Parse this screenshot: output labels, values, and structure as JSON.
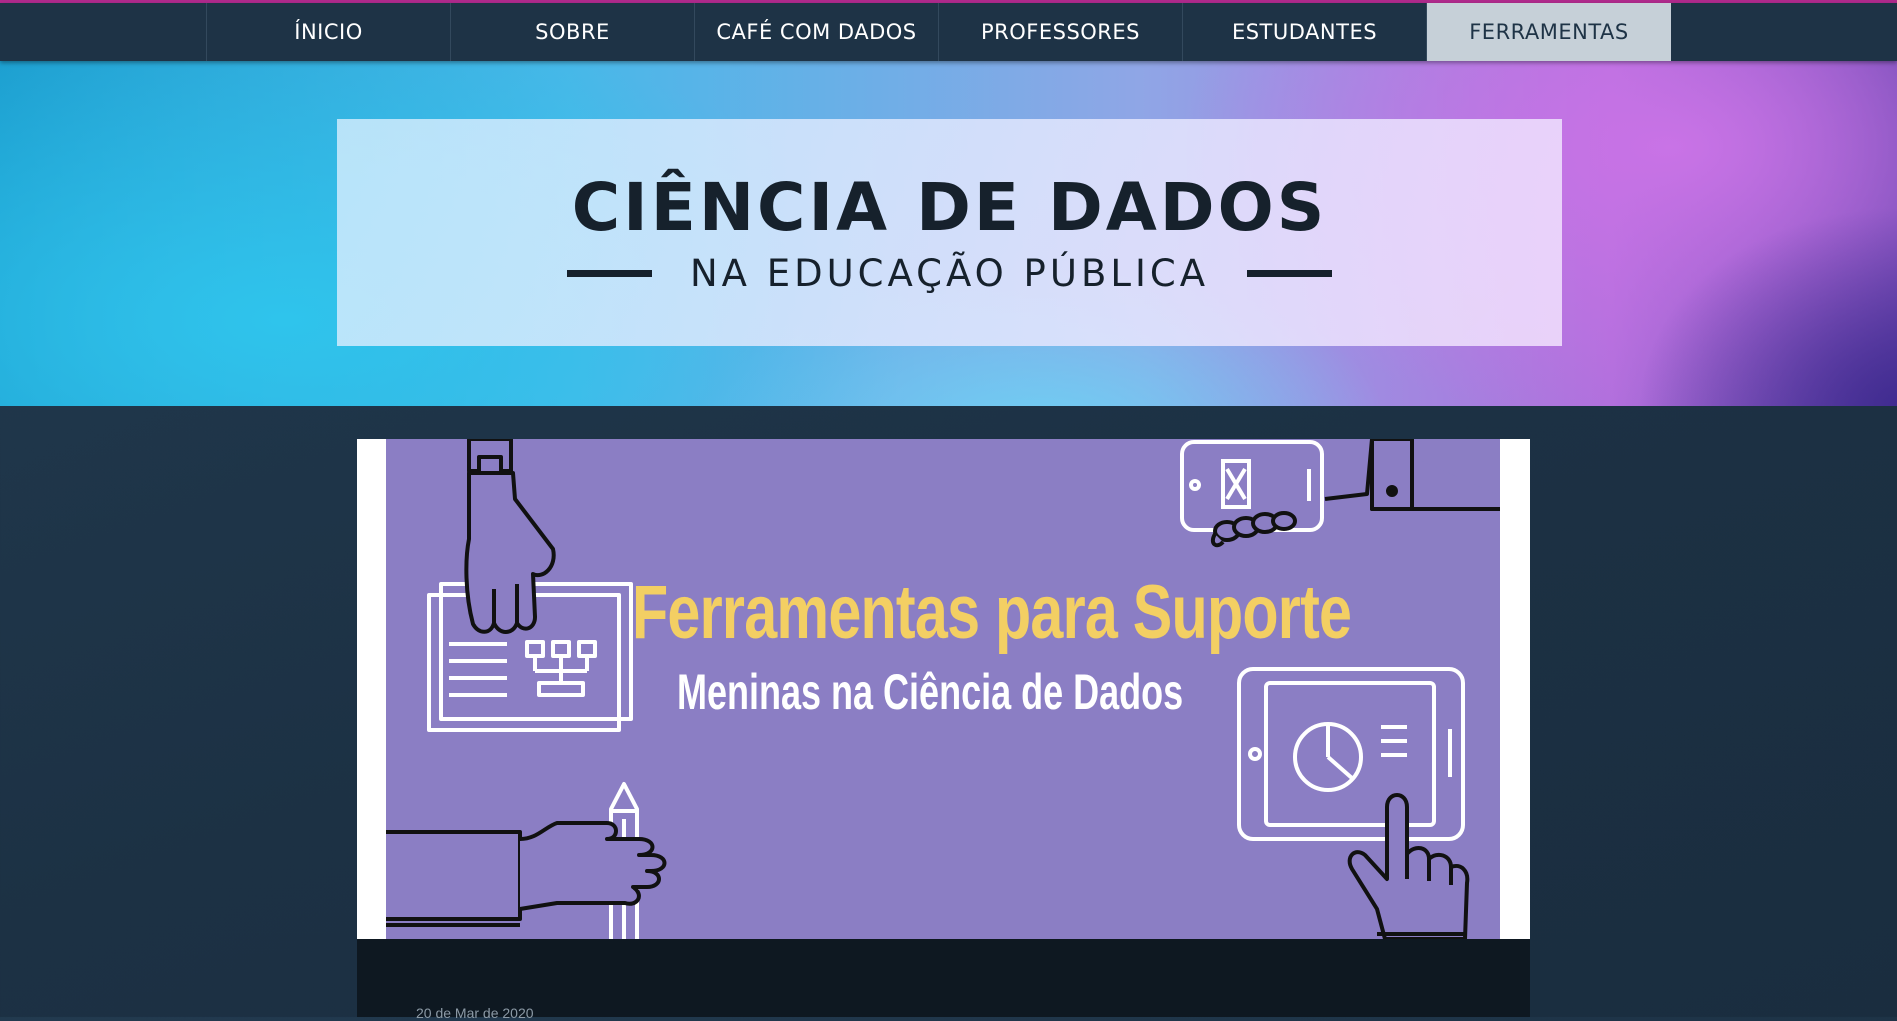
{
  "nav": {
    "items": [
      {
        "label": "ÍNICIO"
      },
      {
        "label": "SOBRE"
      },
      {
        "label": "CAFÉ COM DADOS"
      },
      {
        "label": "PROFESSORES"
      },
      {
        "label": "ESTUDANTES"
      },
      {
        "label": "FERRAMENTAS"
      }
    ],
    "active": "FERRAMENTAS"
  },
  "header": {
    "title": "CIÊNCIA DE DADOS",
    "subtitle": "NA EDUCAÇÃO PÚBLICA"
  },
  "post": {
    "image_title": "Ferramentas para Suporte",
    "image_subtitle": "Meninas na Ciência de Dados",
    "date": "20 de Mar de 2020"
  },
  "colors": {
    "topline": "#b02a8c",
    "navbar": "#1e3346",
    "nav_active_bg": "#c6d0d8",
    "image_bg": "#8b7ec4",
    "image_title": "#f3cf63"
  }
}
